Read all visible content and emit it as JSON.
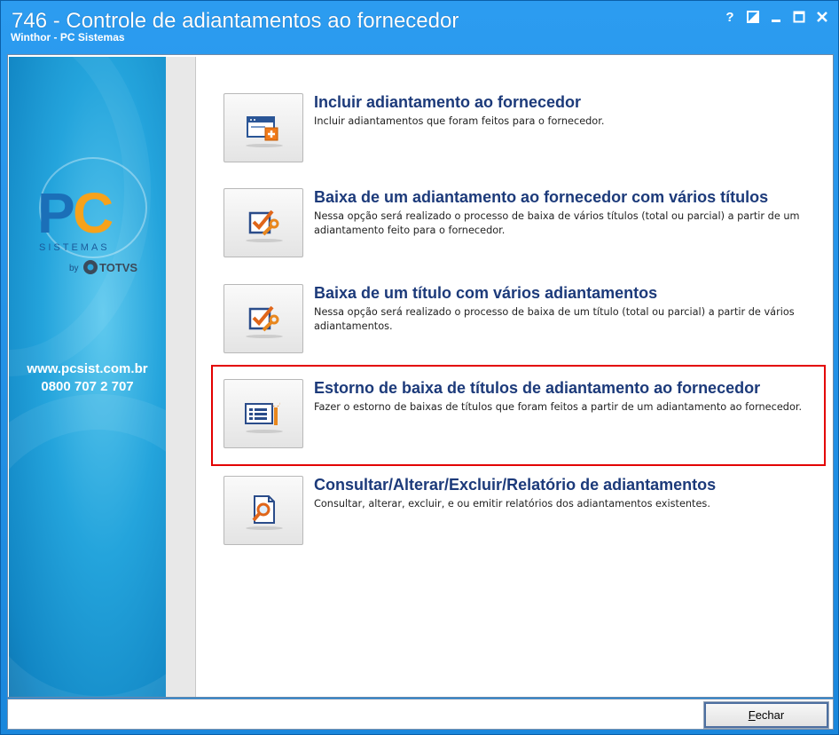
{
  "window": {
    "title": "746 - Controle de adiantamentos ao fornecedor",
    "subtitle": "Winthor - PC Sistemas",
    "controls": [
      "?",
      "restore-icon",
      "minimize-icon",
      "maximize-icon",
      "close-icon"
    ]
  },
  "sidebar": {
    "logo_letters": "PC",
    "logo_sistemas": "SISTEMAS",
    "logo_by": "by",
    "logo_totvs": "TOTVS",
    "website": "www.pcsist.com.br",
    "phone": "0800 707 2 707"
  },
  "options": [
    {
      "title": "Incluir adiantamento ao fornecedor",
      "description": "Incluir adiantamentos que foram feitos para o fornecedor.",
      "icon": "window-add-icon"
    },
    {
      "title": "Baixa de um adiantamento ao fornecedor com vários títulos",
      "description": "Nessa opção será realizado o processo de baixa de vários títulos (total ou parcial) a partir de um adiantamento feito para o fornecedor.",
      "icon": "check-wrench-icon"
    },
    {
      "title": "Baixa de um título com vários adiantamentos",
      "description": "Nessa opção será realizado o processo de baixa de um título (total ou parcial) a partir de vários adiantamentos.",
      "icon": "check-wrench-icon"
    },
    {
      "title": "Estorno de baixa de títulos de adiantamento ao fornecedor",
      "description": "Fazer o estorno de baixas de títulos que foram feitos a partir de um adiantamento ao fornecedor.",
      "icon": "list-wrench-icon",
      "highlighted": true
    },
    {
      "title": "Consultar/Alterar/Excluir/Relatório de adiantamentos",
      "description": "Consultar, alterar, excluir, e ou emitir relatórios dos adiantamentos existentes.",
      "icon": "document-search-icon"
    }
  ],
  "footer": {
    "close_button": "Fechar"
  },
  "colors": {
    "titlebar": "#1a87dc",
    "option_title": "#1c3a7a",
    "highlight_border": "#e30000",
    "logo_blue": "#1b6fb8",
    "logo_orange": "#f7a21b"
  }
}
